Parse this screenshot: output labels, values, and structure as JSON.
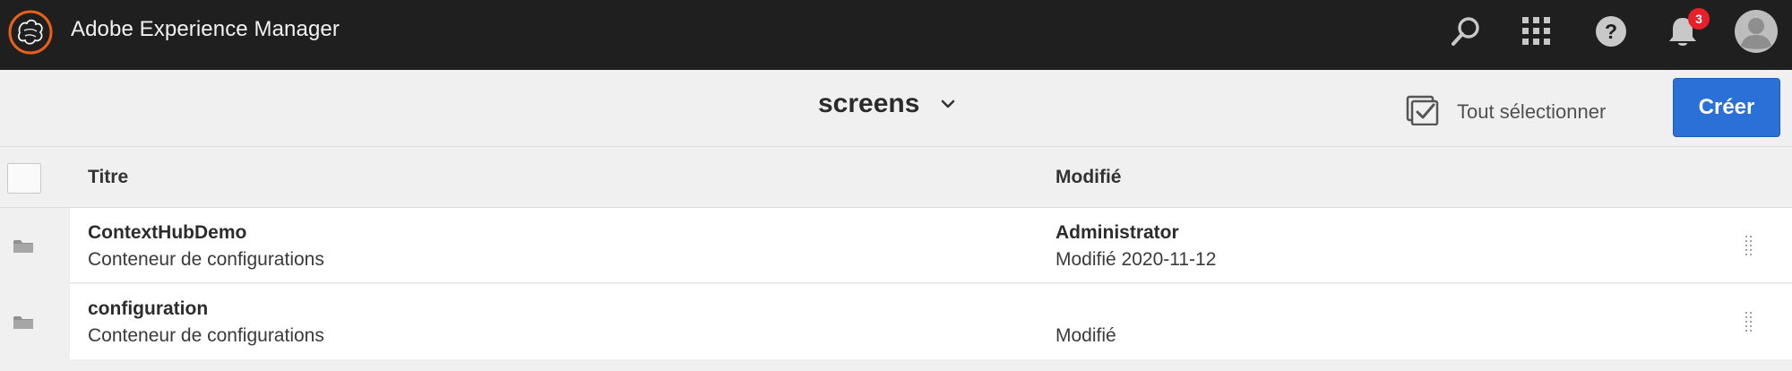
{
  "app": {
    "title": "Adobe Experience Manager"
  },
  "header_icons": {
    "notifications_count": "3"
  },
  "actionbar": {
    "breadcrumb": "screens",
    "select_all_label": "Tout sélectionner",
    "create_label": "Créer"
  },
  "table": {
    "columns": [
      "Titre",
      "Modifié"
    ],
    "rows": [
      {
        "title": "ContextHubDemo",
        "subtitle": "Conteneur de configurations",
        "modified_by": "Administrator",
        "modified": "Modifié 2020-11-12"
      },
      {
        "title": "configuration",
        "subtitle": "Conteneur de configurations",
        "modified_by": "",
        "modified": "Modifié"
      }
    ]
  },
  "colors": {
    "topbar": "#1f1f1f",
    "accent": "#2a70d6",
    "logo": "#e8601c",
    "badge": "#e8202a"
  }
}
